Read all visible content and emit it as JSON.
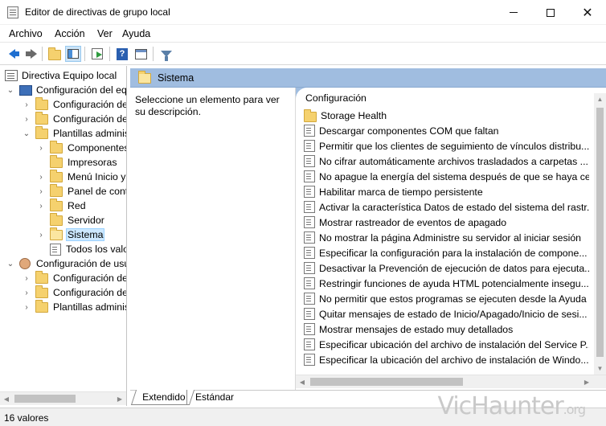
{
  "window": {
    "title": "Editor de directivas de grupo local"
  },
  "menu": [
    "Archivo",
    "Acción",
    "Ver",
    "Ayuda"
  ],
  "toolbar": {
    "buttons": [
      "back-icon",
      "forward-icon",
      "up-folder-icon",
      "show-hide-tree-icon",
      "export-list-icon",
      "help-icon",
      "properties-icon",
      "filter-icon"
    ]
  },
  "tree": {
    "nodes": [
      {
        "label": "Directiva Equipo local",
        "level": 0,
        "expander": "",
        "icon": "policy"
      },
      {
        "label": "Configuración del equipo",
        "level": 1,
        "expander": "v",
        "icon": "pc"
      },
      {
        "label": "Configuración de software",
        "level": 2,
        "expander": ">",
        "icon": "folder"
      },
      {
        "label": "Configuración de Windows",
        "level": 2,
        "expander": ">",
        "icon": "folder"
      },
      {
        "label": "Plantillas administrativas",
        "level": 2,
        "expander": "v",
        "icon": "folder"
      },
      {
        "label": "Componentes de Windows",
        "level": 3,
        "expander": ">",
        "icon": "folder"
      },
      {
        "label": "Impresoras",
        "level": 3,
        "expander": "",
        "icon": "folder"
      },
      {
        "label": "Menú Inicio y barra de tareas",
        "level": 3,
        "expander": ">",
        "icon": "folder"
      },
      {
        "label": "Panel de control",
        "level": 3,
        "expander": ">",
        "icon": "folder"
      },
      {
        "label": "Red",
        "level": 3,
        "expander": ">",
        "icon": "folder"
      },
      {
        "label": "Servidor",
        "level": 3,
        "expander": "",
        "icon": "folder"
      },
      {
        "label": "Sistema",
        "level": 3,
        "expander": ">",
        "icon": "folder-open",
        "selected": true
      },
      {
        "label": "Todos los valores",
        "level": 3,
        "expander": "",
        "icon": "doc"
      },
      {
        "label": "Configuración de usuario",
        "level": 1,
        "expander": "v",
        "icon": "user"
      },
      {
        "label": "Configuración de software",
        "level": 2,
        "expander": ">",
        "icon": "folder"
      },
      {
        "label": "Configuración de Windows",
        "level": 2,
        "expander": ">",
        "icon": "folder"
      },
      {
        "label": "Plantillas administrativas",
        "level": 2,
        "expander": ">",
        "icon": "folder"
      }
    ]
  },
  "pathbar": {
    "label": "Sistema"
  },
  "description": {
    "text": "Seleccione un elemento para ver su descripción."
  },
  "list": {
    "column_header": "Configuración",
    "items": [
      {
        "label": "Storage Health",
        "icon": "folder"
      },
      {
        "label": "Descargar componentes COM que faltan",
        "icon": "doc"
      },
      {
        "label": "Permitir que los clientes de seguimiento de vínculos distribu...",
        "icon": "doc"
      },
      {
        "label": "No cifrar automáticamente archivos trasladados a carpetas ...",
        "icon": "doc"
      },
      {
        "label": "No apague la energía del sistema después de que se haya ce...",
        "icon": "doc"
      },
      {
        "label": "Habilitar marca de tiempo persistente",
        "icon": "doc"
      },
      {
        "label": "Activar la característica Datos de estado del sistema del rastr...",
        "icon": "doc"
      },
      {
        "label": "Mostrar rastreador de eventos de apagado",
        "icon": "doc"
      },
      {
        "label": "No mostrar la página Administre su servidor al iniciar sesión",
        "icon": "doc"
      },
      {
        "label": "Especificar la configuración para la instalación de compone...",
        "icon": "doc"
      },
      {
        "label": "Desactivar la Prevención de ejecución de datos para ejecuta...",
        "icon": "doc"
      },
      {
        "label": "Restringir funciones de ayuda HTML potencialmente insegu...",
        "icon": "doc"
      },
      {
        "label": "No permitir que estos programas se ejecuten desde la Ayuda",
        "icon": "doc"
      },
      {
        "label": "Quitar mensajes de estado de Inicio/Apagado/Inicio de sesi...",
        "icon": "doc"
      },
      {
        "label": "Mostrar mensajes de estado muy detallados",
        "icon": "doc"
      },
      {
        "label": "Especificar ubicación del archivo de instalación del Service P...",
        "icon": "doc"
      },
      {
        "label": "Especificar la ubicación del archivo de instalación de Windo...",
        "icon": "doc"
      }
    ]
  },
  "tabs": {
    "extended": "Extendido",
    "standard": "Estándar"
  },
  "status": {
    "text": "16 valores"
  },
  "watermark": {
    "text": "VicHaunter",
    "suffix": ".org"
  },
  "colors": {
    "pathbar": "#a0bde0",
    "selection": "#cce8ff",
    "folder": "#f5d16e"
  }
}
